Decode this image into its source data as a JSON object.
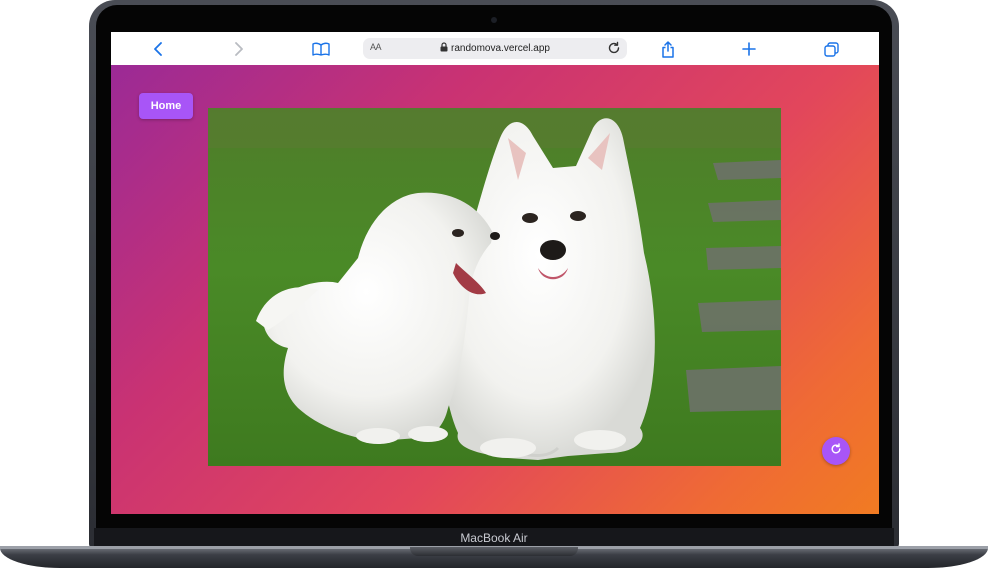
{
  "device": {
    "brand_label": "MacBook Air"
  },
  "browser": {
    "text_size_label": "AA",
    "url": "randomova.vercel.app",
    "icons": {
      "back": "chevron-left-icon",
      "forward": "chevron-right-icon",
      "bookmarks": "book-icon",
      "lock": "lock-icon",
      "reload": "reload-icon",
      "share": "share-icon",
      "new_tab": "plus-icon",
      "tabs": "tabs-icon"
    },
    "accent_color": "#1a73e8"
  },
  "page": {
    "home_button_label": "Home",
    "button_color": "#a855f7",
    "background_gradient": [
      "#9b2a96",
      "#e2465c",
      "#f17b22"
    ],
    "image_alt": "Two white Samoyed dogs, an adult and a puppy, lying on green grass",
    "refresh_icon": "refresh-icon"
  }
}
